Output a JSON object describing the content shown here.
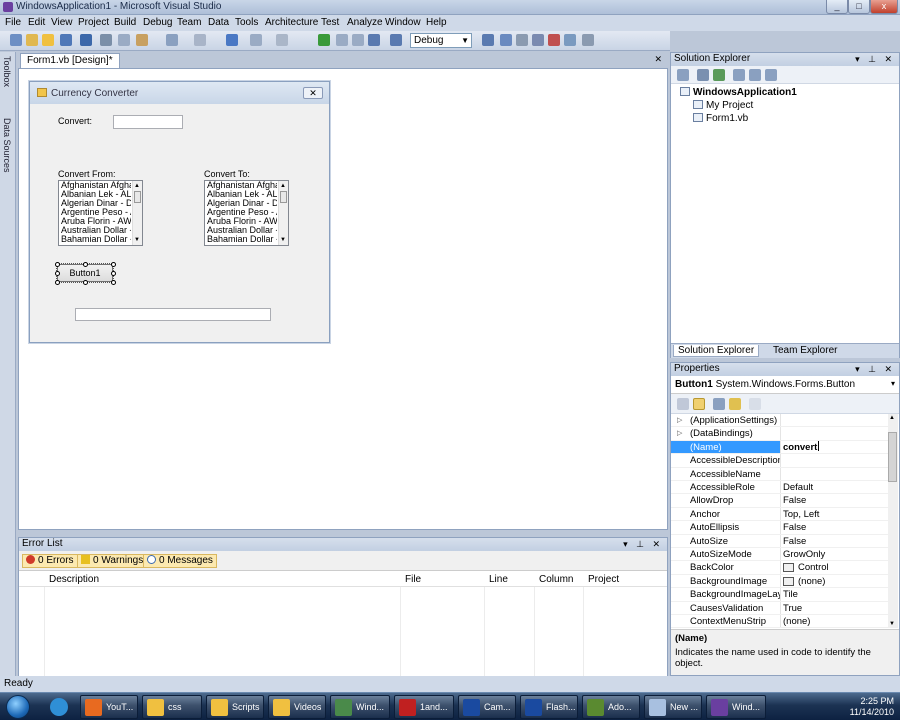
{
  "window": {
    "title": "WindowsApplication1 - Microsoft Visual Studio",
    "min": "_",
    "max": "□",
    "close": "x"
  },
  "menu": [
    "File",
    "Edit",
    "View",
    "Project",
    "Build",
    "Debug",
    "Team",
    "Data",
    "Tools",
    "Architecture",
    "Test",
    "Analyze",
    "Window",
    "Help"
  ],
  "toolbar": {
    "config": "Debug"
  },
  "rail": {
    "toolbox": "Toolbox",
    "datasources": "Data Sources"
  },
  "doc_tab": "Form1.vb [Design]*",
  "form": {
    "title": "Currency Converter",
    "convert_label": "Convert:",
    "from_label": "Convert From:",
    "to_label": "Convert To:",
    "list_items": [
      "Afghanistan Afghani",
      "Albanian Lek - ALL",
      "Algerian Dinar - DZD",
      "Argentine Peso - AR",
      "Aruba Florin - AWG",
      "Australian Dollar - AU",
      "Bahamian Dollar - BS"
    ],
    "button": "Button1"
  },
  "error_list": {
    "title": "Error List",
    "errors": "0 Errors",
    "warnings": "0 Warnings",
    "messages": "0 Messages",
    "columns": [
      "Description",
      "File",
      "Line",
      "Column",
      "Project"
    ]
  },
  "solution_explorer": {
    "title": "Solution Explorer",
    "tree": [
      "WindowsApplication1",
      "My Project",
      "Form1.vb"
    ],
    "tabs": [
      "Solution Explorer",
      "Team Explorer"
    ]
  },
  "properties": {
    "title": "Properties",
    "object_name": "Button1",
    "object_type": "System.Windows.Forms.Button",
    "rows": [
      {
        "name": "(ApplicationSettings)",
        "value": "",
        "expand": true
      },
      {
        "name": "(DataBindings)",
        "value": "",
        "expand": true
      },
      {
        "name": "(Name)",
        "value": "convert",
        "selected": true
      },
      {
        "name": "AccessibleDescription",
        "value": ""
      },
      {
        "name": "AccessibleName",
        "value": ""
      },
      {
        "name": "AccessibleRole",
        "value": "Default"
      },
      {
        "name": "AllowDrop",
        "value": "False"
      },
      {
        "name": "Anchor",
        "value": "Top, Left"
      },
      {
        "name": "AutoEllipsis",
        "value": "False"
      },
      {
        "name": "AutoSize",
        "value": "False"
      },
      {
        "name": "AutoSizeMode",
        "value": "GrowOnly"
      },
      {
        "name": "BackColor",
        "value": "Control",
        "swatch": true
      },
      {
        "name": "BackgroundImage",
        "value": "(none)",
        "swatch": true
      },
      {
        "name": "BackgroundImageLayout",
        "value": "Tile"
      },
      {
        "name": "CausesValidation",
        "value": "True"
      },
      {
        "name": "ContextMenuStrip",
        "value": "(none)"
      }
    ],
    "desc_title": "(Name)",
    "desc_text": "Indicates the name used in code to identify the object."
  },
  "status": "Ready",
  "taskbar": {
    "tasks": [
      "YouT...",
      "css",
      "Scripts",
      "Videos",
      "Wind...",
      "1and...",
      "Cam...",
      "Flash...",
      "Ado...",
      "New ...",
      "Wind..."
    ],
    "time": "2:25 PM",
    "date": "11/14/2010"
  },
  "colors": {
    "accent": "#3399ff",
    "vs_bg": "#bcc7d8"
  }
}
